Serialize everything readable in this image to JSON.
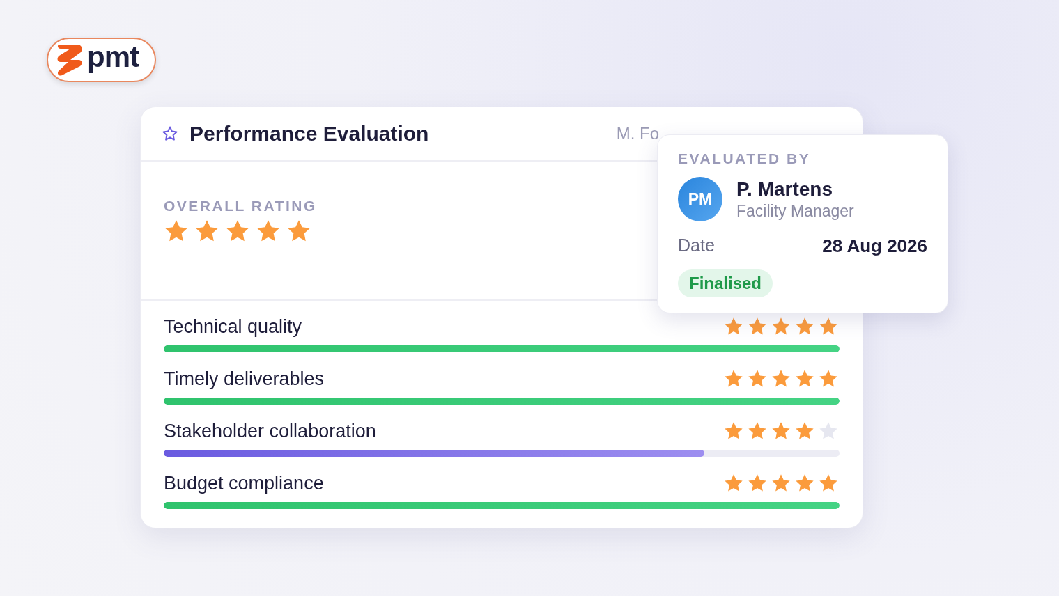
{
  "logo": {
    "text": "pmt"
  },
  "card": {
    "title": "Performance Evaluation",
    "meta": "M. Fo",
    "overall": {
      "label": "OVERALL RATING",
      "stars": 5
    },
    "criteria": [
      {
        "name": "Technical quality",
        "stars": 5,
        "level": 1
      },
      {
        "name": "Timely deliverables",
        "stars": 5,
        "level": 1
      },
      {
        "name": "Stakeholder collaboration",
        "stars": 4,
        "level": 0.8
      },
      {
        "name": "Budget compliance",
        "stars": 5,
        "level": 1
      }
    ]
  },
  "evaluator": {
    "heading": "EVALUATED BY",
    "initials": "PM",
    "name": "P. Martens",
    "role": "Facility Manager",
    "date_label": "Date",
    "date": "28 Aug 2026",
    "status": "Finalised"
  }
}
